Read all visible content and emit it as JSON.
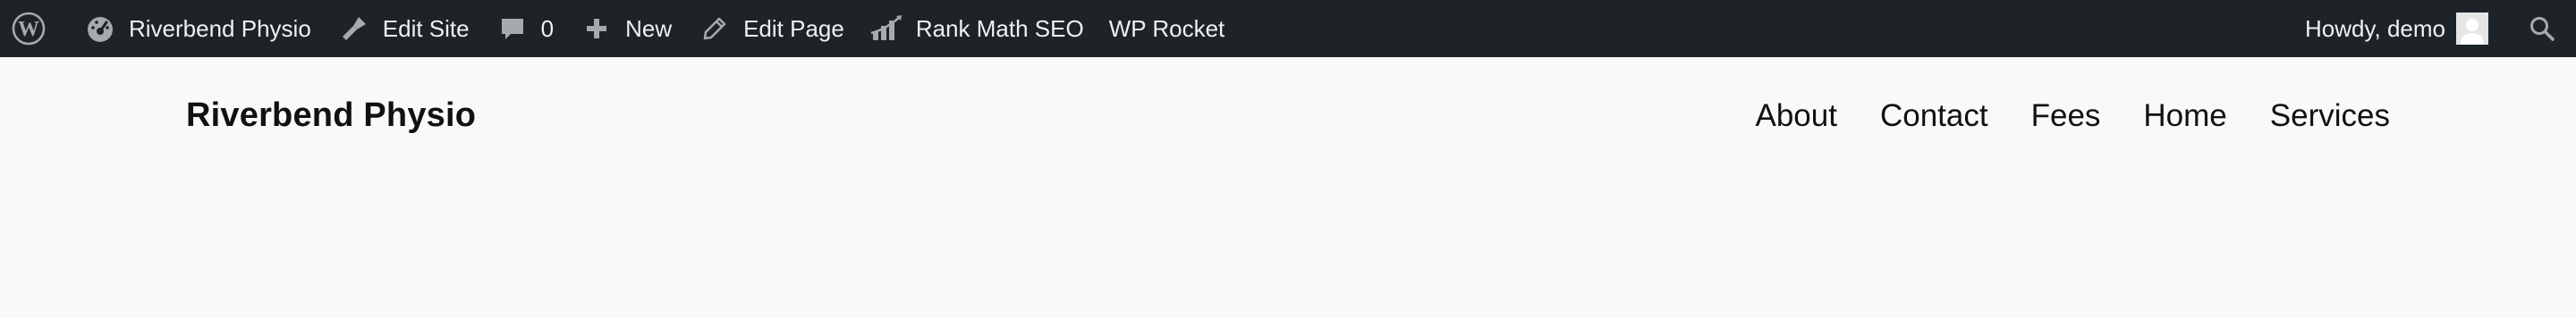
{
  "adminbar": {
    "wp_logo_icon": "wordpress-icon",
    "site_name": "Riverbend Physio",
    "site_icon": "dashboard-gauge-icon",
    "edit_site": "Edit Site",
    "edit_site_icon": "brush-icon",
    "comments_count": "0",
    "comments_icon": "comment-bubble-icon",
    "new_label": "New",
    "new_icon": "plus-icon",
    "edit_page": "Edit Page",
    "edit_page_icon": "pencil-icon",
    "rank_math": "Rank Math SEO",
    "rank_math_icon": "rank-math-chart-icon",
    "wp_rocket": "WP Rocket",
    "howdy": "Howdy, demo",
    "avatar_icon": "user-avatar-icon",
    "search_icon": "search-icon",
    "colors": {
      "background": "#1d2327",
      "text": "#f0f0f1",
      "icon": "#a7aaad"
    }
  },
  "header": {
    "site_title": "Riverbend Physio",
    "nav": [
      {
        "label": "About"
      },
      {
        "label": "Contact"
      },
      {
        "label": "Fees"
      },
      {
        "label": "Home"
      },
      {
        "label": "Services"
      }
    ]
  },
  "page": {
    "background": "#f9f9f9"
  }
}
